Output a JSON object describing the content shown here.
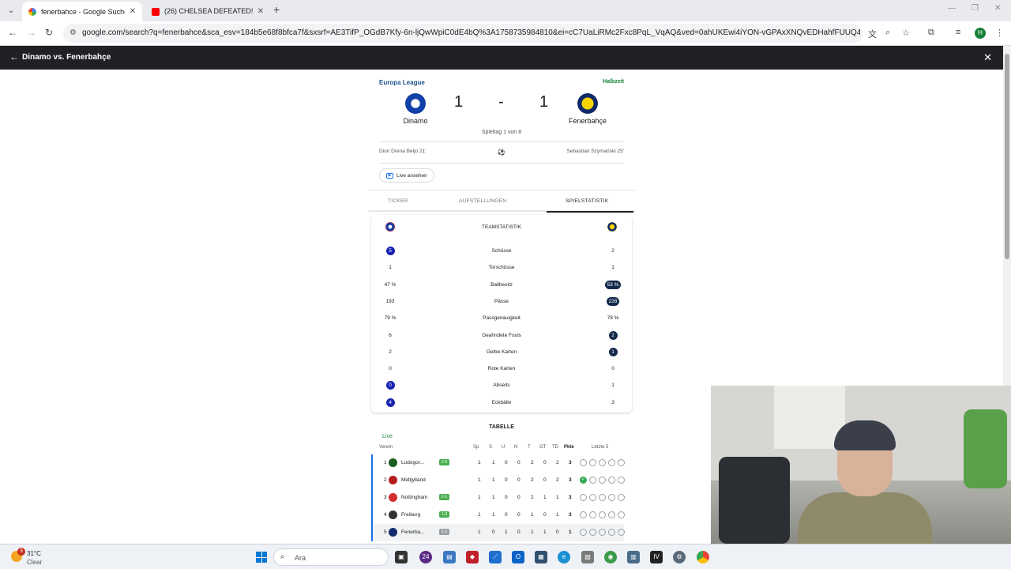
{
  "browser": {
    "tabs": [
      {
        "title": "fenerbahce - Google Suche",
        "close": "✕"
      },
      {
        "title": "(26) CHELSEA DEFEATED! 👏 | Fi",
        "close": "✕"
      }
    ],
    "new_tab": "+",
    "url": "google.com/search?q=fenerbahce&sca_esv=184b5e68f8bfca7f&sxsrf=AE3TifP_OGdB7Kfy-6n-ljQwWpiC0dE4bQ%3A1758735984810&ei=cC7UaLiRMc2Fxc8PqL_VqAQ&ved=0ahUKEwi4iYON-vGPAxXNQvEDHahfFUUQ4dUDCBA&uact=5&o...",
    "profile_initial": "H"
  },
  "overlay": {
    "title": "Dinamo vs. Fenerbahçe"
  },
  "match": {
    "competition": "Europa League",
    "status": "Halbzeit",
    "home_team": "Dinamo",
    "away_team": "Fenerbahçe",
    "home_score": "1",
    "separator": "-",
    "away_score": "1",
    "matchday": "Spieltag 1 von 8",
    "home_scorer": "Dion Drena Beljo 21'",
    "away_scorer": "Sebastian Szymański 25'",
    "live_button": "Live ansehen",
    "tabs": [
      "TICKER",
      "AUFSTELLUNGEN",
      "SPIELSTATISTIK"
    ]
  },
  "stats": {
    "heading": "TEAMSTATISTIK",
    "rows": [
      {
        "label": "Schüsse",
        "home": "5",
        "away": "2",
        "hl": "home"
      },
      {
        "label": "Torschüsse",
        "home": "1",
        "away": "1",
        "hl": "none"
      },
      {
        "label": "Ballbesitz",
        "home": "47 %",
        "away": "53 %",
        "hl": "away"
      },
      {
        "label": "Pässe",
        "home": "193",
        "away": "228",
        "hl": "away"
      },
      {
        "label": "Passgenauigkeit",
        "home": "79 %",
        "away": "78 %",
        "hl": "none"
      },
      {
        "label": "Geahndete Fouls",
        "home": "6",
        "away": "2",
        "hl": "away"
      },
      {
        "label": "Gelbe Karten",
        "home": "2",
        "away": "1",
        "hl": "away"
      },
      {
        "label": "Rote Karten",
        "home": "0",
        "away": "0",
        "hl": "none"
      },
      {
        "label": "Abseits",
        "home": "0",
        "away": "1",
        "hl": "home"
      },
      {
        "label": "Eckbälle",
        "home": "4",
        "away": "3",
        "hl": "home"
      }
    ]
  },
  "table": {
    "title": "TABELLE",
    "live": "Live",
    "headers": {
      "team": "Verein",
      "sp": "Sp",
      "s": "S",
      "u": "U",
      "n": "N",
      "t": "T",
      "gt": "GT",
      "td": "TD",
      "pkte": "Pkte",
      "last5": "Letzte 5"
    },
    "rows": [
      {
        "pos": "1",
        "team": "Ludogor...",
        "live": "2-0",
        "sp": "1",
        "s": "1",
        "u": "0",
        "n": "0",
        "t": "2",
        "gt": "0",
        "td": "2",
        "pkte": "3"
      },
      {
        "pos": "2",
        "team": "Midtjylland",
        "live": "",
        "sp": "1",
        "s": "1",
        "u": "0",
        "n": "0",
        "t": "2",
        "gt": "0",
        "td": "2",
        "pkte": "3"
      },
      {
        "pos": "3",
        "team": "Nottingham",
        "live": "2-1",
        "sp": "1",
        "s": "1",
        "u": "0",
        "n": "0",
        "t": "2",
        "gt": "1",
        "td": "1",
        "pkte": "3"
      },
      {
        "pos": "4",
        "team": "Freiburg",
        "live": "1-0",
        "sp": "1",
        "s": "1",
        "u": "0",
        "n": "0",
        "t": "1",
        "gt": "0",
        "td": "1",
        "pkte": "3"
      },
      {
        "pos": "5",
        "team": "Fenerba...",
        "live": "1-1",
        "sp": "1",
        "s": "0",
        "u": "1",
        "n": "0",
        "t": "1",
        "gt": "1",
        "td": "0",
        "pkte": "1"
      }
    ]
  },
  "taskbar": {
    "weather_badge": "3",
    "temperature": "31°C",
    "condition": "Clear",
    "search_placeholder": "Ara"
  },
  "colors": {
    "accent_blue": "#1a22b0",
    "accent_navy": "#13294b",
    "live_green": "#188038"
  }
}
